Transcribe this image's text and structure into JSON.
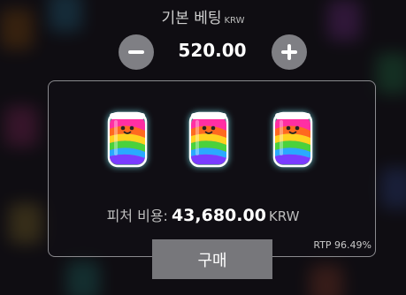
{
  "bet": {
    "title": "기본 베팅",
    "currency": "KRW",
    "value": "520.00"
  },
  "symbols": [
    {
      "name": "rainbow-jar-icon"
    },
    {
      "name": "rainbow-jar-icon"
    },
    {
      "name": "rainbow-jar-icon"
    }
  ],
  "feature": {
    "cost_label": "피처 비용:",
    "cost_value": "43,680.00",
    "currency": "KRW"
  },
  "buy_label": "구매",
  "rtp": "RTP 96.49%",
  "colors": {
    "background": "#0f0d12",
    "button_gray": "#77777b",
    "panel_border": "#8a8a8e",
    "glow": "#7ff5ff"
  }
}
